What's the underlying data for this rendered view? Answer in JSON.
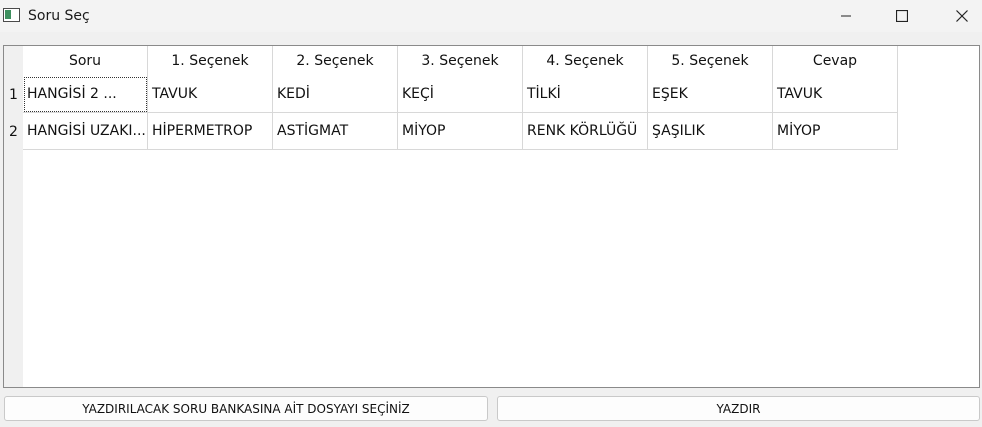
{
  "window": {
    "title": "Soru Seç"
  },
  "table": {
    "columns": [
      "Soru",
      "1. Seçenek",
      "2. Seçenek",
      "3. Seçenek",
      "4. Seçenek",
      "5. Seçenek",
      "Cevap"
    ],
    "rows": [
      {
        "num": "1",
        "cells": [
          "HANGİSİ 2 ...",
          "TAVUK",
          "KEDİ",
          "KEÇİ",
          "TİLKİ",
          "EŞEK",
          "TAVUK"
        ]
      },
      {
        "num": "2",
        "cells": [
          "HANGİSİ UZAKI...",
          "HİPERMETROP",
          "ASTİGMAT",
          "MİYOP",
          "RENK KÖRLÜĞÜ",
          "ŞAŞILIK",
          "MİYOP"
        ]
      }
    ]
  },
  "buttons": {
    "select_file": "YAZDIRILACAK SORU BANKASINA AİT DOSYAYI SEÇİNİZ",
    "print": "YAZDIR"
  },
  "icons": {
    "app": "app-window-icon",
    "minimize": "minimize-icon",
    "maximize": "maximize-icon",
    "close": "close-icon"
  }
}
